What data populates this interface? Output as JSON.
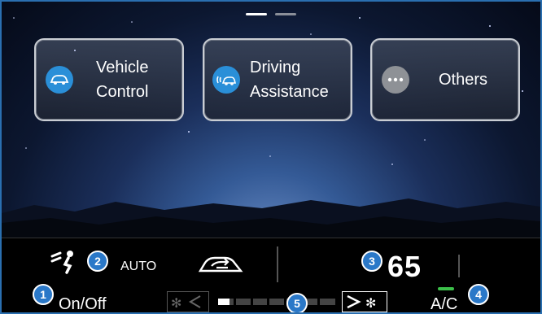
{
  "pager": {
    "active_color": "#ffffff",
    "inactive_color": "#8a8f99"
  },
  "tiles": [
    {
      "label_line1": "Vehicle",
      "label_line2": "Control",
      "icon": "car-icon",
      "icon_color": "#2a8fd8"
    },
    {
      "label_line1": "Driving",
      "label_line2": "Assistance",
      "icon": "car-signal-icon",
      "icon_color": "#2a8fd8"
    },
    {
      "label_line1": "Others",
      "icon": "more-dots-icon",
      "icon_color": "#8e9196"
    }
  ],
  "climate": {
    "badges": [
      "1",
      "2",
      "3",
      "4",
      "5"
    ],
    "on_off_label": "On/Off",
    "auto_label": "AUTO",
    "temperature": "65",
    "ac_label": "A/C",
    "ac_indicator_color": "#3cc04a",
    "fan_level_fraction": 0.1,
    "icons": {
      "vent": "vent-person-icon",
      "recirc": "recirculation-car-icon",
      "fan_down": "fan-decrease-icon",
      "fan_up": "fan-increase-icon"
    }
  }
}
